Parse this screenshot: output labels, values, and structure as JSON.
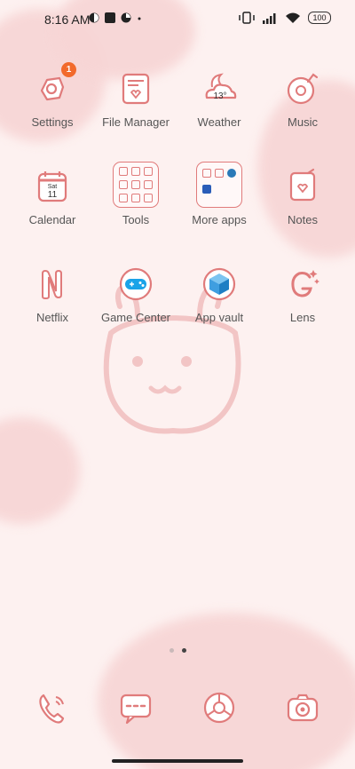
{
  "status_bar": {
    "time": "8:16 AM",
    "battery": "100"
  },
  "apps": [
    {
      "label": "Settings",
      "icon": "settings-gear-icon",
      "badge": "1"
    },
    {
      "label": "File Manager",
      "icon": "file-manager-icon"
    },
    {
      "label": "Weather",
      "icon": "weather-cloud-moon-icon",
      "temp": "13°"
    },
    {
      "label": "Music",
      "icon": "music-disc-icon"
    },
    {
      "label": "Calendar",
      "icon": "calendar-icon",
      "day": "Sat",
      "date": "11"
    },
    {
      "label": "Tools",
      "icon": "tools-folder-icon"
    },
    {
      "label": "More apps",
      "icon": "more-apps-folder-icon"
    },
    {
      "label": "Notes",
      "icon": "notes-icon"
    },
    {
      "label": "Netflix",
      "icon": "netflix-icon"
    },
    {
      "label": "Game Center",
      "icon": "game-controller-icon"
    },
    {
      "label": "App vault",
      "icon": "app-vault-cube-icon"
    },
    {
      "label": "Lens",
      "icon": "lens-icon"
    }
  ],
  "dock": [
    {
      "name": "phone",
      "icon": "phone-icon"
    },
    {
      "name": "messages",
      "icon": "messages-icon"
    },
    {
      "name": "browser",
      "icon": "browser-icon"
    },
    {
      "name": "camera",
      "icon": "camera-icon"
    }
  ],
  "page_indicator": {
    "pages": 2,
    "current": 2
  },
  "colors": {
    "accent": "#e07b7b",
    "badge": "#f26a2c",
    "background": "#fdf1f0"
  }
}
